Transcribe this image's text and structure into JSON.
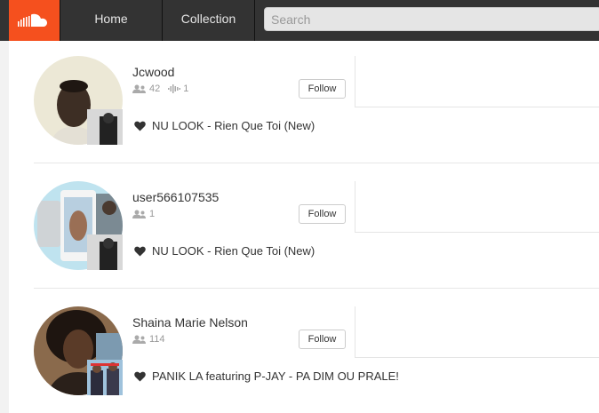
{
  "header": {
    "logo_icon": "soundcloud-logo-icon",
    "brand_color": "#f5501e",
    "nav": [
      {
        "label": "Home"
      },
      {
        "label": "Collection"
      }
    ],
    "search": {
      "placeholder": "Search",
      "value": ""
    }
  },
  "users": [
    {
      "username": "Jcwood",
      "followers": "42",
      "tracks": "1",
      "follow_label": "Follow",
      "liked_track": "NU LOOK - Rien Que Toi (New)"
    },
    {
      "username": "user566107535",
      "followers": "1",
      "follow_label": "Follow",
      "liked_track": "NU LOOK - Rien Que Toi (New)"
    },
    {
      "username": "Shaina Marie Nelson",
      "followers": "114",
      "follow_label": "Follow",
      "liked_track": "PANIK LA featuring P-JAY - PA DIM OU PRALE!"
    }
  ]
}
